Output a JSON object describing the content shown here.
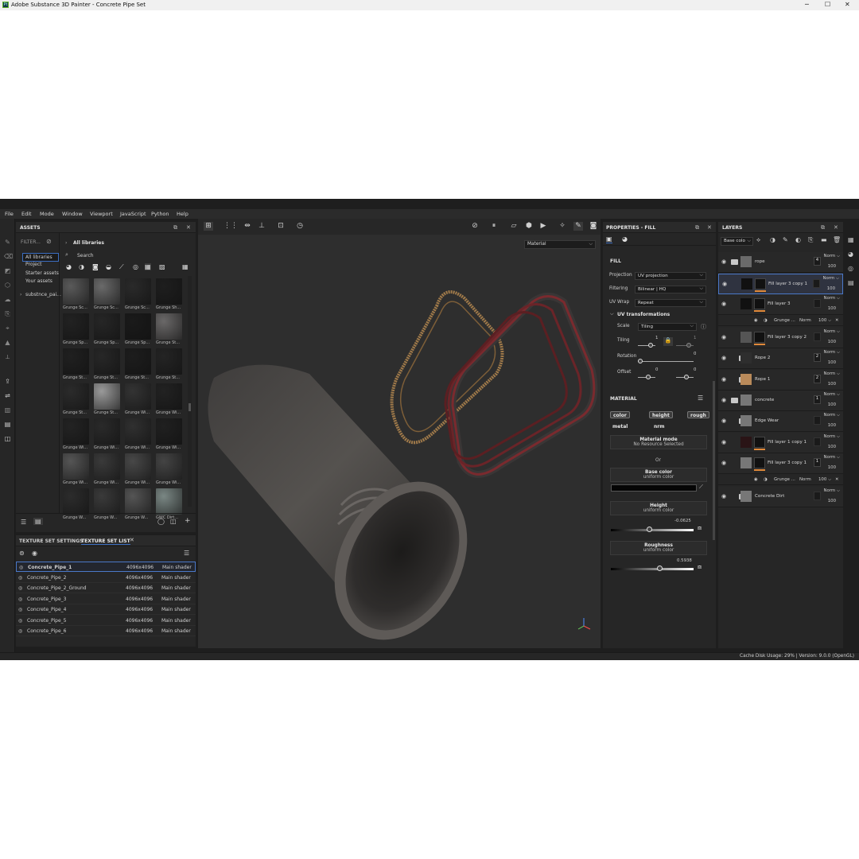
{
  "window": {
    "title": "Adobe Substance 3D Painter - Concrete Pipe Set",
    "logo": "Pt",
    "minimize": "─",
    "maximize": "☐",
    "close": "✕"
  },
  "menu": [
    "File",
    "Edit",
    "Mode",
    "Window",
    "Viewport",
    "JavaScript",
    "Python",
    "Help"
  ],
  "assets": {
    "title": "ASSETS",
    "filter_label": "FILTER...",
    "libraries": [
      "All libraries",
      "Project",
      "Starter assets",
      "Your assets"
    ],
    "sub_library": "substnce_pai...",
    "crumb": "All libraries",
    "search_placeholder": "Search",
    "thumbs": [
      "Grunge Sc...",
      "Grunge Sc...",
      "Grunge Sc...",
      "Grunge Sh...",
      "Grunge Sp...",
      "Grunge Sp...",
      "Grunge Sp...",
      "Grunge St...",
      "Grunge St...",
      "Grunge St...",
      "Grunge St...",
      "Grunge St...",
      "Grunge St...",
      "Grunge St...",
      "Grunge Wi...",
      "Grunge Wi...",
      "Grunge Wi...",
      "Grunge Wi...",
      "Grunge Wi...",
      "Grunge Wi...",
      "Grunge Wi...",
      "Grunge Wi...",
      "Grunge Wi...",
      "Grunge Wi...",
      "Grunge W...",
      "Grunge W...",
      "Grunge W...",
      "GWC Dirt..."
    ]
  },
  "texture_sets": {
    "tab_settings": "TEXTURE SET SETTINGS",
    "tab_list": "TEXTURE SET LIST",
    "rows": [
      {
        "name": "Concrete_Pipe_1",
        "res": "4096x4096",
        "shader": "Main shader"
      },
      {
        "name": "Concrete_Pipe_2",
        "res": "4096x4096",
        "shader": "Main shader"
      },
      {
        "name": "Concrete_Pipe_2_Ground",
        "res": "4096x4096",
        "shader": "Main shader"
      },
      {
        "name": "Concrete_Pipe_3",
        "res": "4096x4096",
        "shader": "Main shader"
      },
      {
        "name": "Concrete_Pipe_4",
        "res": "4096x4096",
        "shader": "Main shader"
      },
      {
        "name": "Concrete_Pipe_5",
        "res": "4096x4096",
        "shader": "Main shader"
      },
      {
        "name": "Concrete_Pipe_6",
        "res": "4096x4096",
        "shader": "Main shader"
      }
    ]
  },
  "viewport": {
    "display_mode": "Material"
  },
  "properties": {
    "title": "PROPERTIES - FILL",
    "fill_section": "FILL",
    "projection_label": "Projection",
    "projection_value": "UV projection",
    "filtering_label": "Filtering",
    "filtering_value": "Bilinear | HQ",
    "uvwrap_label": "UV Wrap",
    "uvwrap_value": "Repeat",
    "uv_transform_label": "UV transformations",
    "scale_label": "Scale",
    "scale_value": "Tiling",
    "tiling_label": "Tiling",
    "tiling_value": "1",
    "tiling_value_2": "1",
    "rotation_label": "Rotation",
    "rotation_value": "0",
    "offset_label": "Offset",
    "offset_x": "0",
    "offset_y": "0",
    "material_section": "MATERIAL",
    "channels": [
      "color",
      "height",
      "rough",
      "metal",
      "nrm"
    ],
    "material_mode_title": "Material mode",
    "material_mode_value": "No Resource Selected",
    "or_label": "Or",
    "base_color_title": "Base color",
    "base_color_sub": "uniform color",
    "base_color_hex": "#050505",
    "height_title": "Height",
    "height_sub": "uniform color",
    "height_value": "-0.0625",
    "roughness_title": "Roughness",
    "roughness_sub": "uniform color",
    "roughness_value": "0.5938"
  },
  "layers": {
    "title": "LAYERS",
    "channel_select": "Base colo",
    "items": [
      {
        "name": "rope",
        "blend": "Norm",
        "opacity": "100",
        "badge": "4"
      },
      {
        "name": "Fill layer 3 copy 1",
        "blend": "Norm",
        "opacity": "100"
      },
      {
        "name": "Fill layer 3",
        "blend": "Norm",
        "opacity": "100"
      },
      {
        "name": "Fill layer 3 copy 2",
        "blend": "Norm",
        "opacity": "100"
      },
      {
        "name": "Rope 2",
        "blend": "Norm",
        "opacity": "100",
        "badge": "2"
      },
      {
        "name": "Rope 1",
        "blend": "Norm",
        "opacity": "100",
        "badge": "2"
      },
      {
        "name": "concrete",
        "blend": "Norm",
        "opacity": "100",
        "badge": "1"
      },
      {
        "name": "Edge Wear",
        "blend": "Norm",
        "opacity": "100"
      },
      {
        "name": "Fill layer 1 copy 1",
        "blend": "Norm",
        "opacity": "100"
      },
      {
        "name": "Fill layer 3 copy 1",
        "blend": "Norm",
        "opacity": "100",
        "badge": "1"
      },
      {
        "name": "Concrete Dirt",
        "blend": "Norm",
        "opacity": "100"
      }
    ],
    "sub1": {
      "name": "Grunge ...",
      "blend": "Norm",
      "opacity": "100"
    },
    "sub2": {
      "name": "Grunge ...",
      "blend": "Norm",
      "opacity": "100"
    }
  },
  "status": "Cache Disk Usage:   29% | Version: 9.0.0 (OpenGL)"
}
